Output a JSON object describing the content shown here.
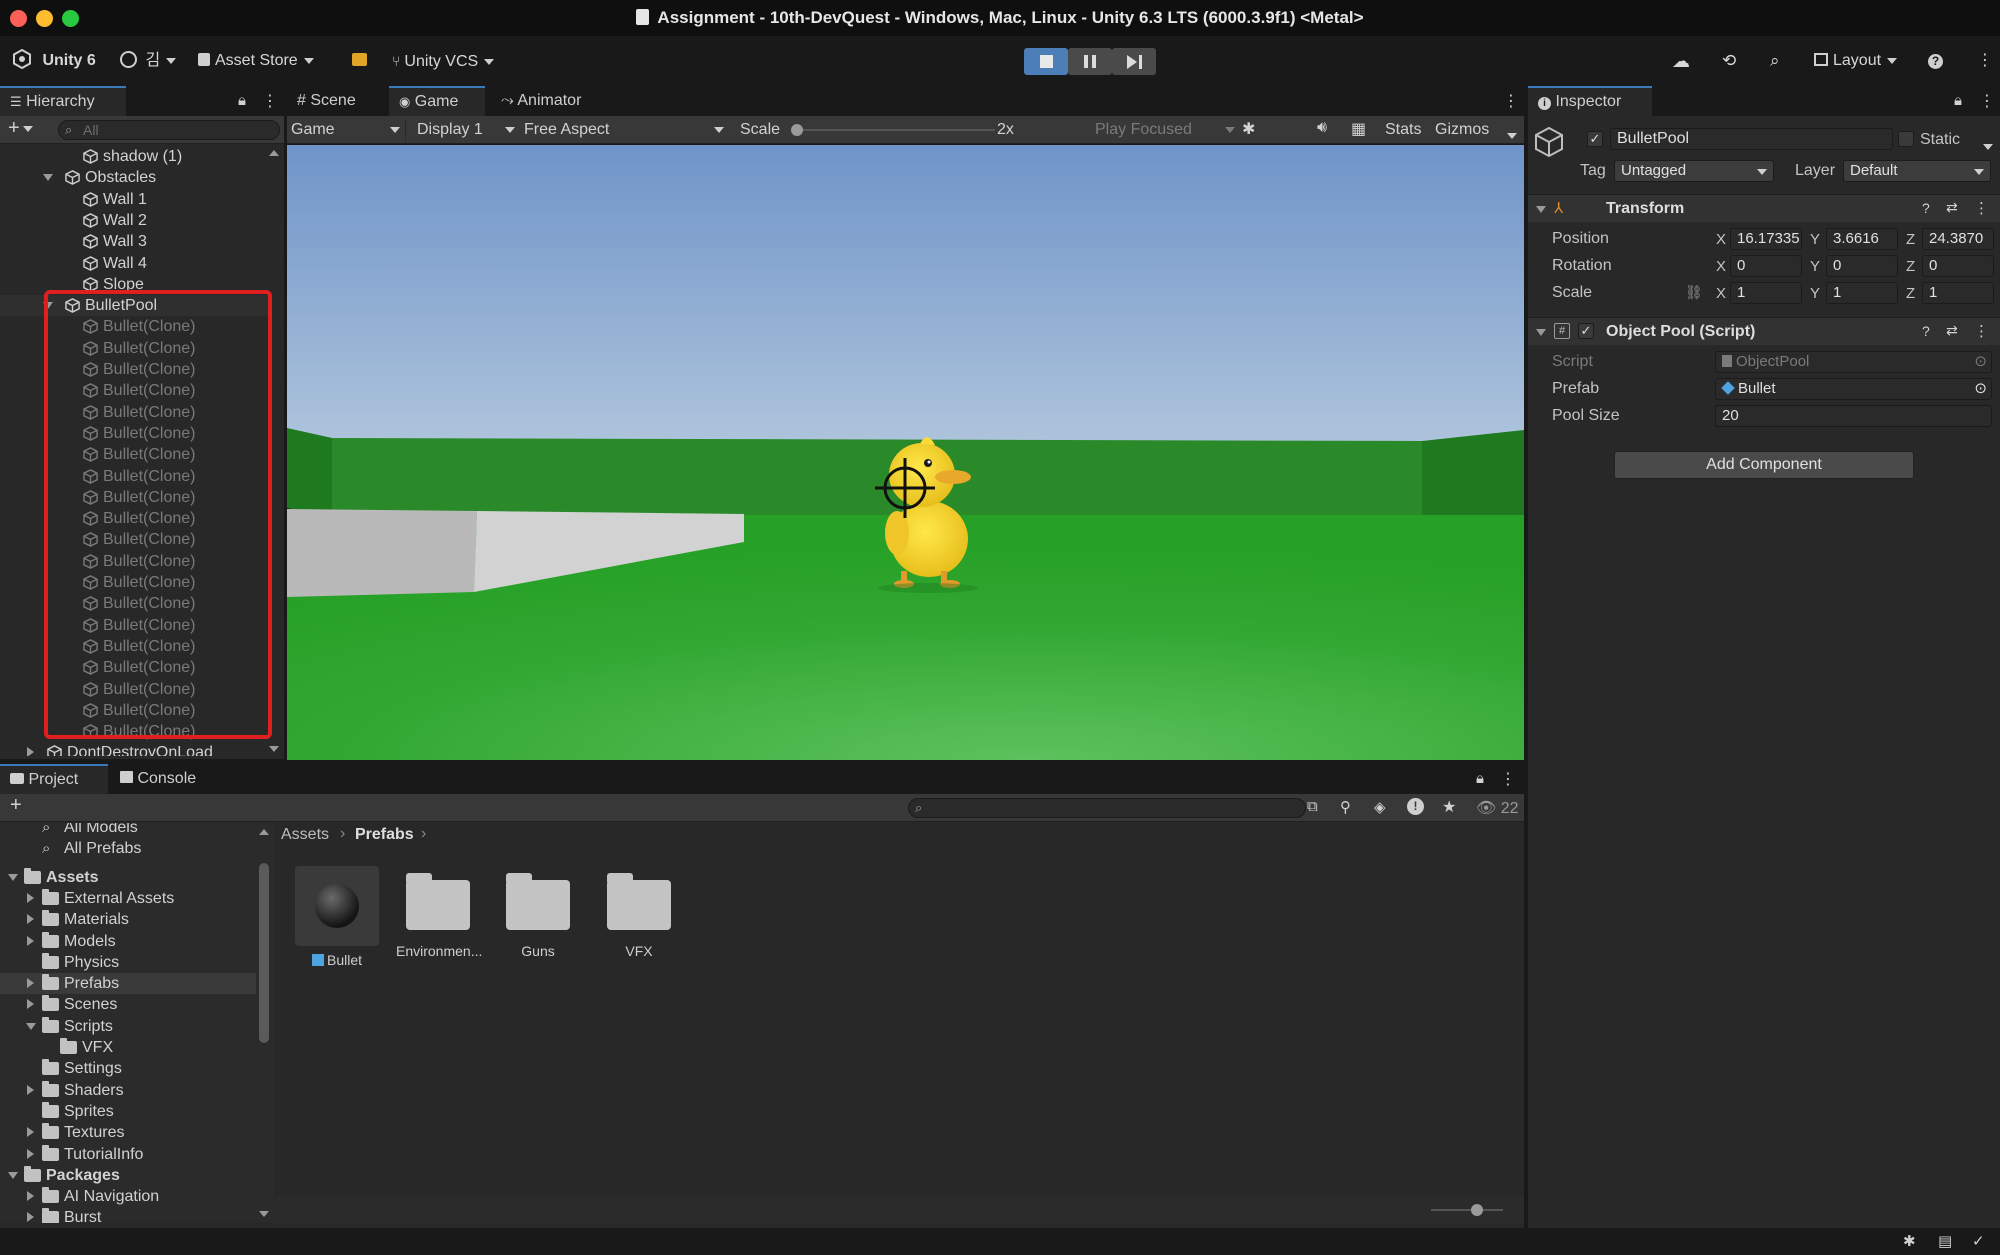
{
  "window": {
    "title": "Assignment - 10th-DevQuest - Windows, Mac, Linux - Unity 6.3 LTS (6000.3.9f1) <Metal>"
  },
  "toolbar": {
    "unity_label": "Unity 6",
    "account_label": "김",
    "asset_store": "Asset Store",
    "vcs": "Unity VCS",
    "layout": "Layout"
  },
  "hierarchy": {
    "tab": "Hierarchy",
    "search_placeholder": "All",
    "items": [
      {
        "label": "shadow (1)",
        "depth": 3
      },
      {
        "label": "Obstacles",
        "depth": 2,
        "expanded": true
      },
      {
        "label": "Wall 1",
        "depth": 3
      },
      {
        "label": "Wall 2",
        "depth": 3
      },
      {
        "label": "Wall 3",
        "depth": 3
      },
      {
        "label": "Wall 4",
        "depth": 3
      },
      {
        "label": "Slope",
        "depth": 3
      }
    ],
    "pool": {
      "label": "BulletPool",
      "children": [
        "Bullet(Clone)",
        "Bullet(Clone)",
        "Bullet(Clone)",
        "Bullet(Clone)",
        "Bullet(Clone)",
        "Bullet(Clone)",
        "Bullet(Clone)",
        "Bullet(Clone)",
        "Bullet(Clone)",
        "Bullet(Clone)",
        "Bullet(Clone)",
        "Bullet(Clone)",
        "Bullet(Clone)",
        "Bullet(Clone)",
        "Bullet(Clone)",
        "Bullet(Clone)",
        "Bullet(Clone)",
        "Bullet(Clone)",
        "Bullet(Clone)",
        "Bullet(Clone)"
      ]
    },
    "dont_destroy": "DontDestroyOnLoad"
  },
  "center_tabs": {
    "scene": "Scene",
    "game": "Game",
    "animator": "Animator"
  },
  "game_toolbar": {
    "mode": "Game",
    "display": "Display 1",
    "aspect": "Free Aspect",
    "scale_label": "Scale",
    "scale_value": "2x",
    "play_focused": "Play Focused",
    "stats": "Stats",
    "gizmos": "Gizmos"
  },
  "inspector": {
    "tab": "Inspector",
    "object_name": "BulletPool",
    "static_label": "Static",
    "tag_label": "Tag",
    "tag_value": "Untagged",
    "layer_label": "Layer",
    "layer_value": "Default",
    "transform": {
      "title": "Transform",
      "position_label": "Position",
      "rotation_label": "Rotation",
      "scale_label": "Scale",
      "position": {
        "x": "16.17335",
        "y": "3.6616",
        "z": "24.3870"
      },
      "rotation": {
        "x": "0",
        "y": "0",
        "z": "0"
      },
      "scale": {
        "x": "1",
        "y": "1",
        "z": "1"
      },
      "axis_x": "X",
      "axis_y": "Y",
      "axis_z": "Z"
    },
    "object_pool": {
      "title": "Object Pool (Script)",
      "script_label": "Script",
      "script_value": "ObjectPool",
      "prefab_label": "Prefab",
      "prefab_value": "Bullet",
      "pool_size_label": "Pool Size",
      "pool_size_value": "20"
    },
    "add_component": "Add Component"
  },
  "project": {
    "tab_project": "Project",
    "tab_console": "Console",
    "hidden_count": "22",
    "favorites": [
      "All Models",
      "All Prefabs"
    ],
    "assets_label": "Assets",
    "folders": [
      {
        "label": "External Assets",
        "has_children": true
      },
      {
        "label": "Materials",
        "has_children": true
      },
      {
        "label": "Models",
        "has_children": true
      },
      {
        "label": "Physics",
        "has_children": false
      },
      {
        "label": "Prefabs",
        "has_children": true,
        "selected": true
      },
      {
        "label": "Scenes",
        "has_children": true
      },
      {
        "label": "Scripts",
        "has_children": true,
        "expanded": true
      },
      {
        "label": "VFX",
        "has_children": false,
        "child": true
      },
      {
        "label": "Settings",
        "has_children": false
      },
      {
        "label": "Shaders",
        "has_children": true
      },
      {
        "label": "Sprites",
        "has_children": false
      },
      {
        "label": "Textures",
        "has_children": true
      },
      {
        "label": "TutorialInfo",
        "has_children": true
      }
    ],
    "packages_label": "Packages",
    "packages": [
      "AI Navigation",
      "Burst"
    ],
    "breadcrumb": [
      "Assets",
      "Prefabs"
    ],
    "grid_items": [
      "Bullet",
      "Environmen...",
      "Guns",
      "VFX"
    ]
  },
  "colors": {
    "selection_outline": "#e0201e",
    "accent": "#3a79bb",
    "sky_top": "#6f94c8",
    "ground": "#2fa22f"
  }
}
